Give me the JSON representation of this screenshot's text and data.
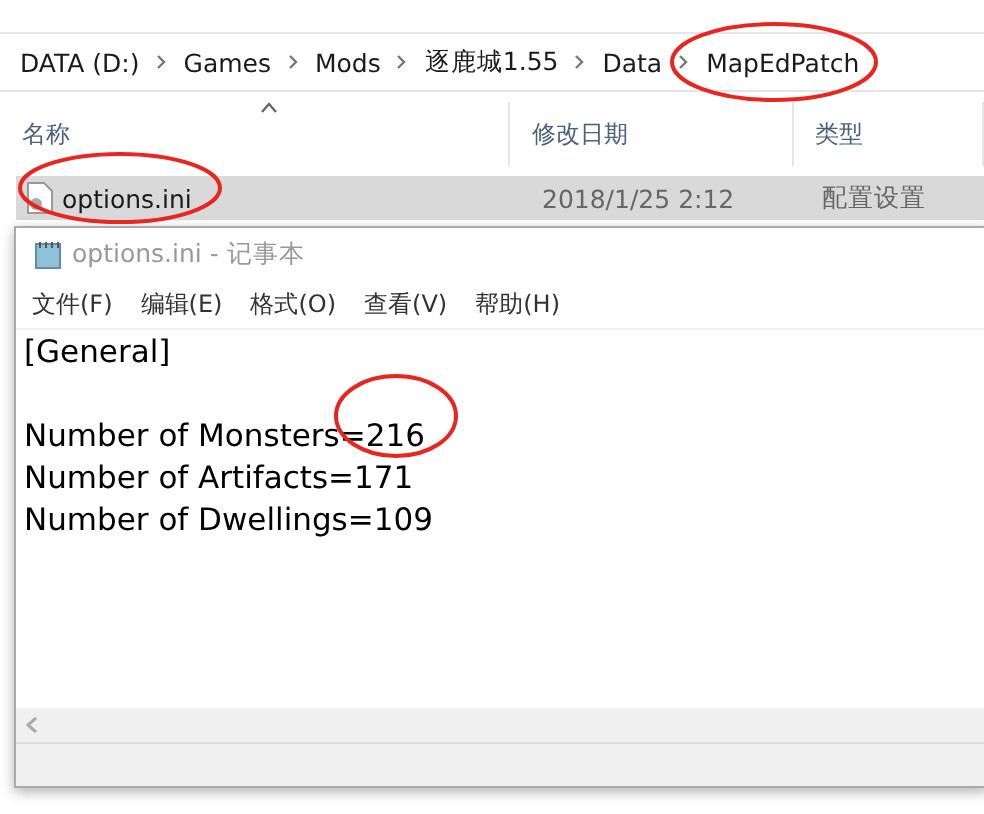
{
  "breadcrumb": [
    "DATA (D:)",
    "Games",
    "Mods",
    "逐鹿城1.55",
    "Data",
    "MapEdPatch"
  ],
  "columns": [
    "名称",
    "修改日期",
    "类型"
  ],
  "files": [
    {
      "name": "options.ini",
      "modified": "2018/1/25 2:12",
      "type": "配置设置",
      "selected": true
    }
  ],
  "notepad": {
    "title": "options.ini - 记事本",
    "menu": [
      "文件(F)",
      "编辑(E)",
      "格式(O)",
      "查看(V)",
      "帮助(H)"
    ],
    "section": "[General]",
    "entries": [
      "Number of Monsters=216",
      "Number of Artifacts=171",
      "Number of Dwellings=109"
    ]
  }
}
